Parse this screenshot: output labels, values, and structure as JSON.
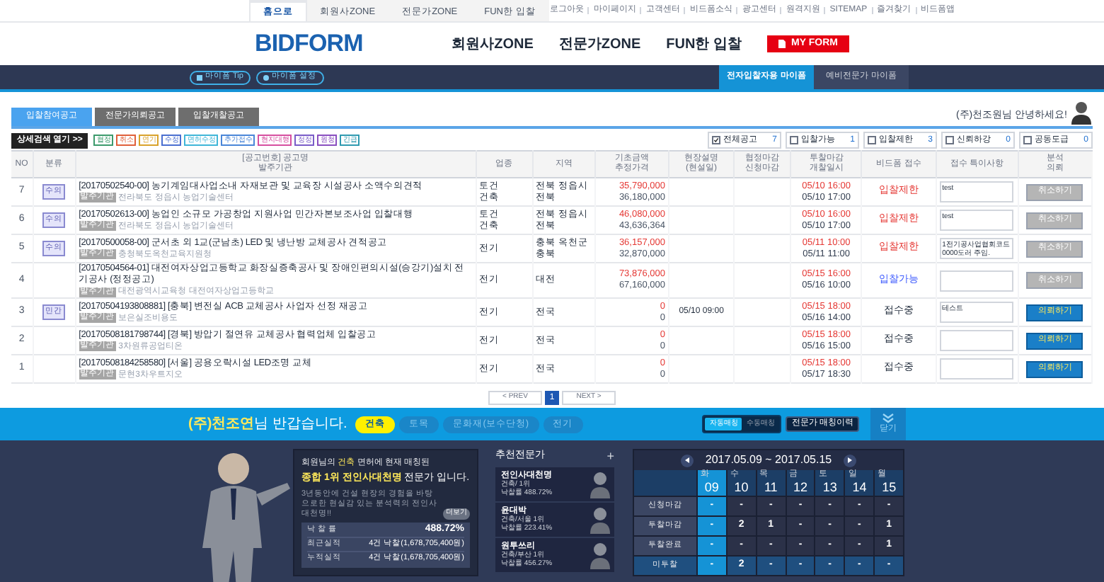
{
  "top_nav": {
    "tabs": [
      {
        "label": "홈으로",
        "selected": true
      },
      {
        "label": "회원사ZONE",
        "selected": false
      },
      {
        "label": "전문가ZONE",
        "selected": false
      },
      {
        "label": "FUN한 입찰",
        "selected": false
      }
    ],
    "links": [
      "로그아웃",
      "마이페이지",
      "고객센터",
      "비드폼소식",
      "광고센터",
      "원격지원",
      "SITEMAP",
      "즐겨찾기",
      "비드폼앱"
    ]
  },
  "header": {
    "logo": "BIDFORM",
    "menu": [
      "회원사ZONE",
      "전문가ZONE",
      "FUN한 입찰"
    ],
    "my_form_button": "MY FORM"
  },
  "sub_bar": {
    "buttons": [
      "마이폼 Tip",
      "마이폼 설정"
    ],
    "tabs": [
      {
        "label": "전자입찰자용 마이폼",
        "selected": true
      },
      {
        "label": "예비전문가 마이폼",
        "selected": false
      }
    ]
  },
  "notice_tabs": [
    {
      "label": "입찰참여공고",
      "selected": true
    },
    {
      "label": "전문가의뢰공고",
      "selected": false
    },
    {
      "label": "입찰개찰공고",
      "selected": false
    }
  ],
  "greeting": "(주)천조원님 안녕하세요!",
  "filter": {
    "detail_button": "상세검색 열기 >>",
    "tags": [
      {
        "label": "협정",
        "color": "#3c9a6c"
      },
      {
        "label": "취소",
        "color": "#e0603a"
      },
      {
        "label": "연기",
        "color": "#d9a22a"
      },
      {
        "label": "수정",
        "color": "#4a6fd0"
      },
      {
        "label": "면허수정",
        "color": "#3fb6d8"
      },
      {
        "label": "추가접수",
        "color": "#4a86d8"
      },
      {
        "label": "현지대행",
        "color": "#d64fa0"
      },
      {
        "label": "정정",
        "color": "#7a5cc8"
      },
      {
        "label": "원청",
        "color": "#8a4fc0"
      },
      {
        "label": "긴급",
        "color": "#2f9ab0"
      }
    ],
    "checkboxes": [
      {
        "label": "전체공고",
        "count": "7",
        "checked": true
      },
      {
        "label": "입찰가능",
        "count": "1",
        "checked": false
      },
      {
        "label": "입찰제한",
        "count": "3",
        "checked": false
      },
      {
        "label": "신뢰하강",
        "count": "0",
        "checked": false
      },
      {
        "label": "공동도급",
        "count": "0",
        "checked": false
      }
    ]
  },
  "table": {
    "columns": [
      "NO",
      "분류",
      "[공고번호] 공고명\n발주기관",
      "업종",
      "지역",
      "기초금액\n추정가격",
      "현장설명\n(현설일)",
      "협정마감\n신청마감",
      "투찰마감\n개찰일시",
      "비드폼 접수",
      "접수 특이사항",
      "분석\n의뢰"
    ],
    "rows": [
      {
        "no": "7",
        "category": "수의",
        "title": "[20170502540-00] 농기계임대사업소내 자재보관 및 교육장 시설공사 소액수의견적",
        "org_tag": "발주기관",
        "org": "전라북도 정읍시 농업기술센터",
        "industry": "토건\n건축",
        "region": "전북 정읍시\n전북",
        "base_price": "35,790,000",
        "est_price": "36,180,000",
        "site_visit": "",
        "bid_deadline": "05/10 16:00",
        "opening": "05/10 17:00",
        "status": {
          "text": "입찰제한",
          "kind": "restricted"
        },
        "note": "test",
        "action": {
          "label": "취소하기",
          "kind": "cancel"
        }
      },
      {
        "no": "6",
        "category": "수의",
        "title": "[20170502613-00] 농업인 소규모 가공창업 지원사업 민간자본보조사업 입찰대행",
        "org_tag": "발주기관",
        "org": "전라북도 정읍시 농업기술센터",
        "industry": "토건\n건축",
        "region": "전북 정읍시\n전북",
        "base_price": "46,080,000",
        "est_price": "43,636,364",
        "site_visit": "",
        "bid_deadline": "05/10 16:00",
        "opening": "05/10 17:00",
        "status": {
          "text": "입찰제한",
          "kind": "restricted"
        },
        "note": "test",
        "action": {
          "label": "취소하기",
          "kind": "cancel"
        }
      },
      {
        "no": "5",
        "category": "수의",
        "title": "[20170500058-00] 군서초 외 1교(군남초) LED 및 냉난방 교체공사 견적공고",
        "org_tag": "발주기관",
        "org": "충청북도옥천교육지원청",
        "industry": "전기",
        "region": "충북 옥천군\n충북",
        "base_price": "36,157,000",
        "est_price": "32,870,000",
        "site_visit": "",
        "bid_deadline": "05/11 10:00",
        "opening": "05/11 11:00",
        "status": {
          "text": "입찰제한",
          "kind": "restricted"
        },
        "note": "1전기공사업협회코드 0000도러 주임.",
        "action": {
          "label": "취소하기",
          "kind": "cancel"
        }
      },
      {
        "no": "4",
        "title": "[20170504564-01] 대전여자상업고등학교 화장실증축공사 및 장애인편의시설(승강기)설치 전기공사 (정정공고)",
        "org_tag": "발주기관",
        "org": "대전광역시교육청 대전여자상업고등학교",
        "industry": "전기",
        "region": "대전",
        "base_price": "73,876,000",
        "est_price": "67,160,000",
        "site_visit": "",
        "bid_deadline": "05/15 16:00",
        "opening": "05/16 10:00",
        "status": {
          "text": "입찰가능",
          "kind": "available"
        },
        "note": "",
        "action": {
          "label": "취소하기",
          "kind": "cancel"
        }
      },
      {
        "no": "3",
        "category": "민간",
        "title": "[20170504193808881] [충북] 변전실 ACB 교체공사 사업자 선정 재공고",
        "org_tag": "발주기관",
        "org": "보은실조비용도",
        "industry": "전기",
        "region": "전국",
        "base_price": "0",
        "est_price": "0",
        "site_visit": "05/10 09:00",
        "bid_deadline": "05/15 18:00",
        "opening": "05/16 14:00",
        "status": {
          "text": "접수중",
          "kind": "receiving"
        },
        "note": "테스트",
        "action": {
          "label": "의뢰하기",
          "kind": "request"
        }
      },
      {
        "no": "2",
        "title": "[20170508181798744] [경북] 방압기 절연유 교체공사 협력업체 입찰공고",
        "org_tag": "발주기관",
        "org": "3차원류공업티온",
        "industry": "전기",
        "region": "전국",
        "base_price": "0",
        "est_price": "0",
        "site_visit": "",
        "bid_deadline": "05/15 18:00",
        "opening": "05/16 15:00",
        "status": {
          "text": "접수중",
          "kind": "receiving"
        },
        "note": "",
        "action": {
          "label": "의뢰하기",
          "kind": "request"
        }
      },
      {
        "no": "1",
        "title": "[20170508184258580] [서울] 공용오락시설 LED조명 교체",
        "org_tag": "발주기관",
        "org": "문현3차우트지오",
        "industry": "전기",
        "region": "전국",
        "base_price": "0",
        "est_price": "0",
        "site_visit": "",
        "bid_deadline": "05/15 18:00",
        "opening": "05/17 18:30",
        "status": {
          "text": "접수중",
          "kind": "receiving"
        },
        "note": "",
        "action": {
          "label": "의뢰하기",
          "kind": "request"
        }
      }
    ]
  },
  "pagination": {
    "prev": "< PREV",
    "pages": [
      {
        "label": "1",
        "selected": true
      }
    ],
    "next": "NEXT >"
  },
  "banner": {
    "company": "(주)천조연",
    "greeting": "님 반갑습니다.",
    "categories": [
      {
        "label": "건축",
        "selected": true
      },
      {
        "label": "토목",
        "selected": false
      },
      {
        "label": "문화재(보수단청)",
        "selected": false
      },
      {
        "label": "전기",
        "selected": false
      }
    ],
    "match_toggle": [
      {
        "label": "자동매칭",
        "selected": true
      },
      {
        "label": "수동매칭",
        "selected": false
      }
    ],
    "history_button": "전문가 매칭이력",
    "close_button": "닫기"
  },
  "expert_card": {
    "lines": [
      [
        {
          "text": "회원님의 ",
          "highlight": false
        },
        {
          "text": "건축",
          "highlight": true
        },
        {
          "text": " 면허에 현재 매칭된",
          "highlight": false
        }
      ],
      [
        {
          "text": "종합 1위 전인사대천명",
          "highlight": true
        },
        {
          "text": " 전문가 입니다.",
          "highlight": false
        }
      ]
    ],
    "description": "3년동안에 건설 현장의 경험을 바탕으로한 현실감 있는 분석력의 전인사 대천명!!",
    "more_button": "더보기",
    "stats": [
      {
        "label": "낙 찰 률",
        "value": "488.72%"
      },
      {
        "label": "최근실적",
        "value": "4건 낙찰(1,678,705,400원)"
      },
      {
        "label": "누적실적",
        "value": "4건 낙찰(1,678,705,400원)"
      }
    ]
  },
  "recommended": {
    "title": "추천전문가",
    "add": "+",
    "experts": [
      {
        "name": "전인사대천명",
        "detail": "건축/ 1위",
        "rate": "낙찰률 488.72%"
      },
      {
        "name": "윤대박",
        "detail": "건축/서울 1위",
        "rate": "낙찰률 223.41%"
      },
      {
        "name": "원투쓰리",
        "detail": "건축/부산 1위",
        "rate": "낙찰률 456.27%"
      }
    ]
  },
  "calendar": {
    "range": "2017.05.09 ~ 2017.05.15",
    "days": [
      {
        "weekday": "화",
        "date": "09",
        "selected": true
      },
      {
        "weekday": "수",
        "date": "10",
        "selected": false
      },
      {
        "weekday": "목",
        "date": "11",
        "selected": false
      },
      {
        "weekday": "금",
        "date": "12",
        "selected": false
      },
      {
        "weekday": "토",
        "date": "13",
        "selected": false
      },
      {
        "weekday": "일",
        "date": "14",
        "selected": false
      },
      {
        "weekday": "월",
        "date": "15",
        "selected": false
      }
    ],
    "rows": [
      {
        "label": "신청마감",
        "highlighted": false,
        "values": [
          "-",
          "-",
          "-",
          "-",
          "-",
          "-",
          "-"
        ]
      },
      {
        "label": "투찰마감",
        "highlighted": false,
        "values": [
          "-",
          "2",
          "1",
          "-",
          "-",
          "-",
          "1"
        ]
      },
      {
        "label": "투찰완료",
        "highlighted": false,
        "values": [
          "-",
          "-",
          "-",
          "-",
          "-",
          "-",
          "1"
        ]
      },
      {
        "label": "미투찰",
        "highlighted": true,
        "values": [
          "-",
          "2",
          "-",
          "-",
          "-",
          "-",
          "-"
        ]
      }
    ]
  }
}
